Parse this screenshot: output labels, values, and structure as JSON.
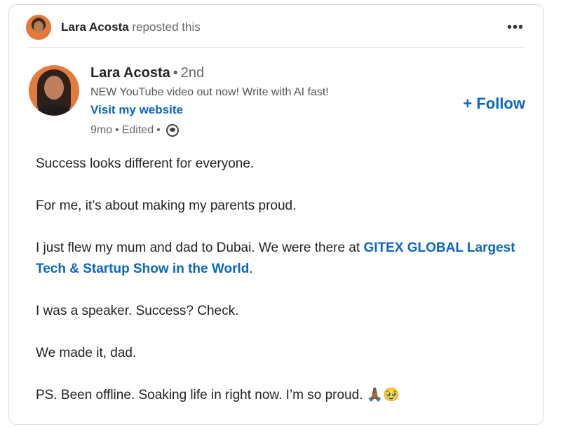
{
  "repost": {
    "name": "Lara Acosta",
    "suffix": "reposted this",
    "more_label": "•••"
  },
  "post": {
    "author": {
      "name": "Lara Acosta",
      "degree": "2nd",
      "headline": "NEW YouTube video out now! Write with AI fast!",
      "website_label": "Visit my website",
      "time": "9mo",
      "edited": "Edited",
      "follow_label": "+ Follow"
    },
    "body": {
      "p1": "Success looks different for everyone.",
      "p2": "For me, it’s about making my parents proud.",
      "p3_before": "I just flew my mum and dad to Dubai. We were there at ",
      "p3_link": "GITEX GLOBAL Largest Tech & Startup Show in the World",
      "p3_after": ".",
      "p4": "I was a speaker. Success? Check.",
      "p5": "We made it, dad.",
      "p6": "PS. Been offline. Soaking life in right now. I’m so proud.",
      "p6_emojis": "🙏🏾🥹"
    }
  }
}
